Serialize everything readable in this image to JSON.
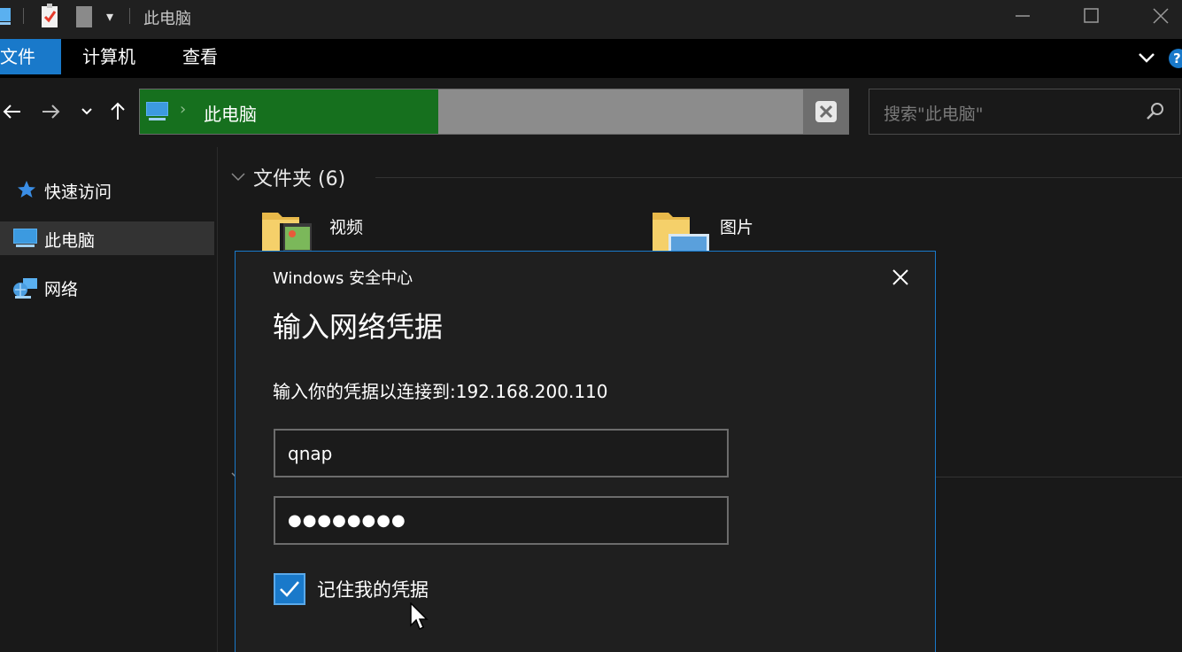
{
  "window": {
    "title": "此电脑",
    "qat_dropdown_glyph": "▾"
  },
  "ribbon": {
    "tabs": [
      {
        "label": "文件",
        "active": true
      },
      {
        "label": "计算机",
        "active": false
      },
      {
        "label": "查看",
        "active": false
      }
    ],
    "help_glyph": "?"
  },
  "navbar": {
    "address_location": "此电脑",
    "address_separator": "›",
    "search_placeholder": "搜索\"此电脑\""
  },
  "sidebar": {
    "items": [
      {
        "label": "快速访问",
        "icon": "star-icon"
      },
      {
        "label": "此电脑",
        "icon": "computer-icon",
        "selected": true
      },
      {
        "label": "网络",
        "icon": "network-icon"
      }
    ]
  },
  "content": {
    "group_header": "文件夹 (6)",
    "folders": [
      {
        "label": "视频",
        "icon": "videos-folder-icon"
      },
      {
        "label": "图片",
        "icon": "pictures-folder-icon"
      }
    ]
  },
  "dialog": {
    "app": "Windows 安全中心",
    "title": "输入网络凭据",
    "message": "输入你的凭据以连接到:192.168.200.110",
    "username": "qnap",
    "password_mask": "●●●●●●●●",
    "remember_label": "记住我的凭据",
    "remember_checked": true
  },
  "colors": {
    "accent": "#1979ca",
    "address_progress": "#16701e",
    "background": "#191919"
  }
}
